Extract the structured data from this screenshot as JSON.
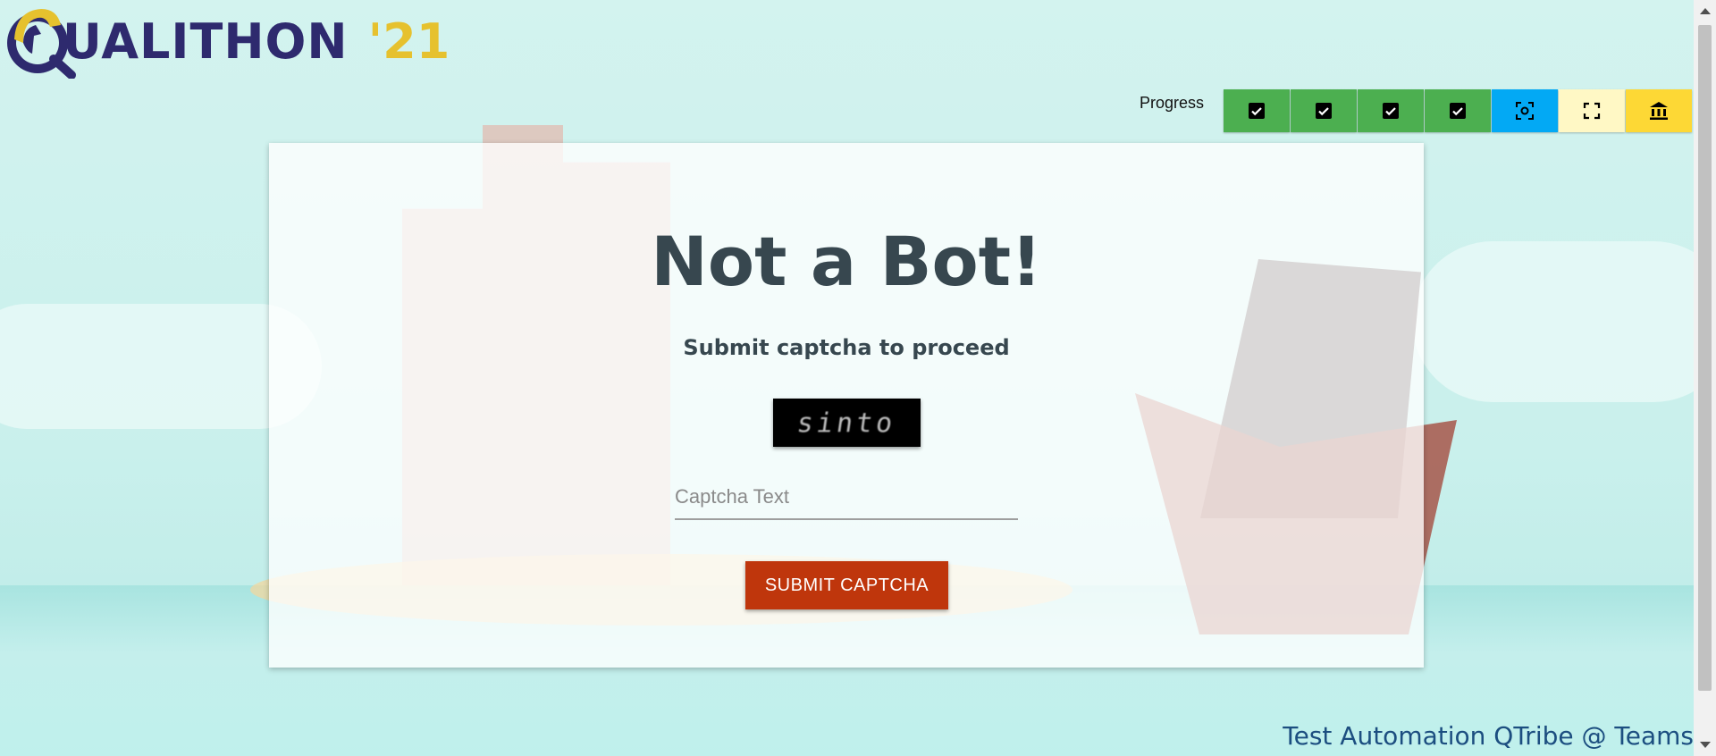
{
  "logo": {
    "name": "UALITHON",
    "year": "'21"
  },
  "progress": {
    "label": "Progress",
    "steps": [
      {
        "state": "done",
        "icon": "checkbox-icon"
      },
      {
        "state": "done",
        "icon": "checkbox-icon"
      },
      {
        "state": "done",
        "icon": "checkbox-icon"
      },
      {
        "state": "done",
        "icon": "checkbox-icon"
      },
      {
        "state": "current",
        "icon": "screen-capture-icon"
      },
      {
        "state": "pending",
        "icon": "fullscreen-icon"
      },
      {
        "state": "final",
        "icon": "bank-icon"
      }
    ]
  },
  "card": {
    "title": "Not a Bot!",
    "subtitle": "Submit captcha to proceed",
    "captcha_text": "sinto",
    "input": {
      "placeholder": "Captcha Text",
      "value": ""
    },
    "submit_label": "SUBMIT CAPTCHA"
  },
  "footer": "Test Automation QTribe @ Teams",
  "colors": {
    "done": "#4caf50",
    "current": "#03a9f4",
    "pending": "#fff8c5",
    "final": "#fdd835",
    "submit": "#bf360c",
    "title": "#37474f"
  }
}
